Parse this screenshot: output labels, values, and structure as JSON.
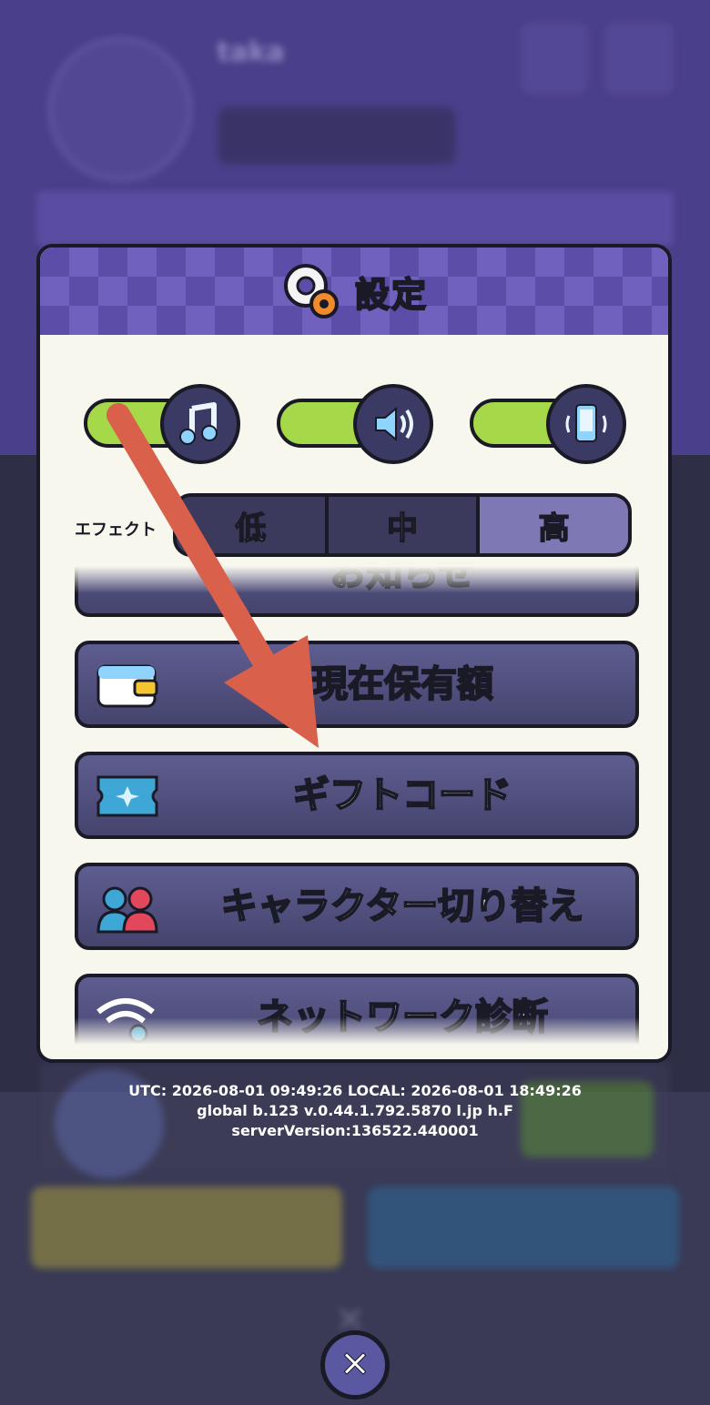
{
  "background": {
    "player_name": "taka"
  },
  "dialog": {
    "title": "設定",
    "toggles": [
      {
        "name": "music",
        "on": true
      },
      {
        "name": "sound",
        "on": true
      },
      {
        "name": "vibration",
        "on": true
      }
    ],
    "effect": {
      "label": "エフェクト",
      "options": [
        "低",
        "中",
        "高"
      ],
      "selected": "高"
    },
    "menu": [
      {
        "label": "お知らせ"
      },
      {
        "label": "現在保有額"
      },
      {
        "label": "ギフトコード"
      },
      {
        "label": "キャラクター切り替え"
      },
      {
        "label": "ネットワーク診断"
      }
    ]
  },
  "info": {
    "line1": "UTC: 2026-08-01 09:49:26 LOCAL: 2026-08-01 18:49:26",
    "line2": "global b.123 v.0.44.1.792.5870 l.jp h.F",
    "line3": "serverVersion:136522.440001"
  },
  "colors": {
    "header_purple": "#5c4ea8",
    "toggle_green": "#a6d94a",
    "button_purple": "#5e5d90",
    "annotation_arrow": "#d9604a"
  }
}
